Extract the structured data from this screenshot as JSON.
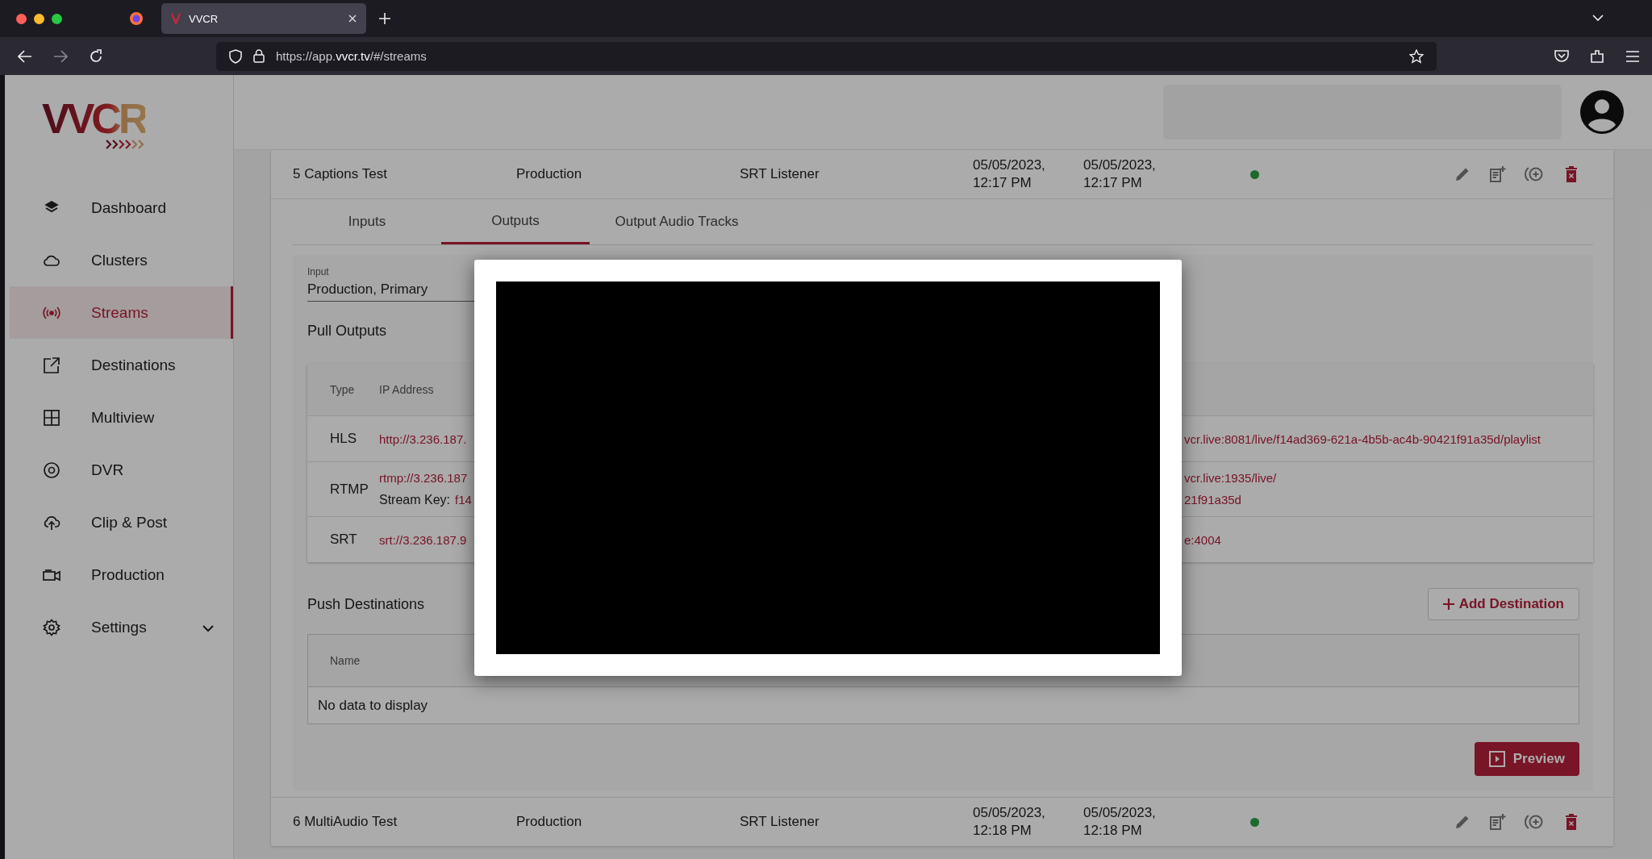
{
  "browser": {
    "tab_title": "VVCR",
    "url": "https://app.**vvcr.tv**/#/streams"
  },
  "sidebar": {
    "logo": "VVCR",
    "items": [
      {
        "label": "Dashboard",
        "selected": false
      },
      {
        "label": "Clusters",
        "selected": false
      },
      {
        "label": "Streams",
        "selected": true
      },
      {
        "label": "Destinations",
        "selected": false
      },
      {
        "label": "Multiview",
        "selected": false
      },
      {
        "label": "DVR",
        "selected": false
      },
      {
        "label": "Clip & Post",
        "selected": false
      },
      {
        "label": "Production",
        "selected": false
      },
      {
        "label": "Settings",
        "selected": false,
        "expandable": true
      }
    ]
  },
  "streams": [
    {
      "name": "5 Captions Test",
      "type": "Production",
      "input": "SRT Listener",
      "created": "05/05/2023, 12:17 PM",
      "updated": "05/05/2023, 12:17 PM",
      "expanded": true
    },
    {
      "name": "6 MultiAudio Test",
      "type": "Production",
      "input": "SRT Listener",
      "created": "05/05/2023, 12:18 PM",
      "updated": "05/05/2023, 12:18 PM",
      "expanded": false
    }
  ],
  "detail": {
    "tabs": [
      {
        "label": "Inputs",
        "selected": false
      },
      {
        "label": "Outputs",
        "selected": true
      },
      {
        "label": "Output Audio Tracks",
        "selected": false
      }
    ],
    "input_field": {
      "label": "Input",
      "value": "Production, Primary"
    },
    "pull_outputs": {
      "title": "Pull Outputs",
      "columns": [
        "Type",
        "IP Address"
      ],
      "rows": [
        {
          "type": "HLS",
          "lines": [
            {
              "left": "http://3.236.187.",
              "right": "vcr.live:8081/live/f14ad369-621a-4b5b-ac4b-90421f91a35d/playlist"
            }
          ]
        },
        {
          "type": "RTMP",
          "lines": [
            {
              "left": "rtmp://3.236.187",
              "right": "vcr.live:1935/live/"
            },
            {
              "prefix": "Stream Key:",
              "left": "f14",
              "right": "21f91a35d"
            }
          ]
        },
        {
          "type": "SRT",
          "lines": [
            {
              "left": "srt://3.236.187.9",
              "right": "e:4004"
            }
          ]
        }
      ]
    },
    "push_destinations": {
      "title": "Push Destinations",
      "add_button": "Add Destination",
      "columns": [
        "Name"
      ],
      "empty_text": "No data to display"
    },
    "preview_button": "Preview"
  },
  "preview_modal": {
    "open": true
  }
}
